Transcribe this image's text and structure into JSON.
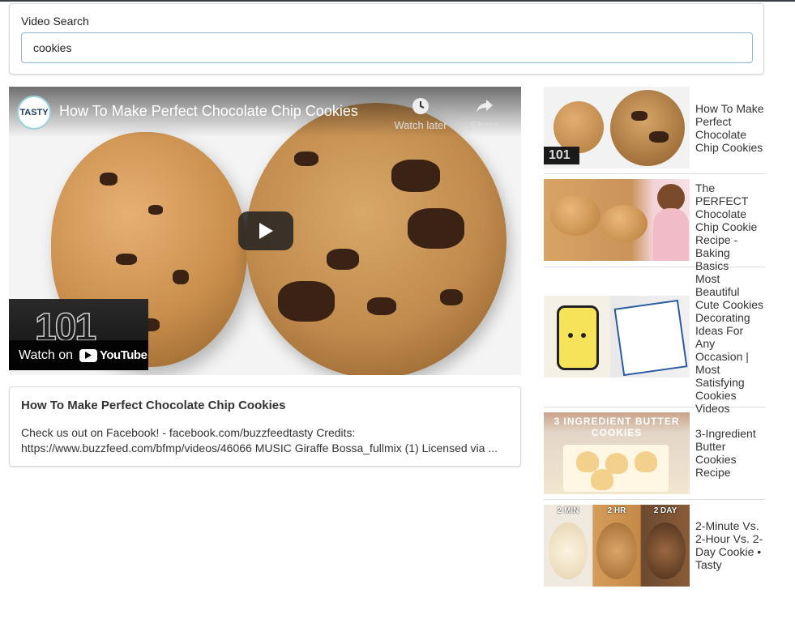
{
  "search": {
    "label": "Video Search",
    "value": "cookies",
    "placeholder": ""
  },
  "player": {
    "channel": "TASTY",
    "title": "How To Make Perfect Chocolate Chip Cookies",
    "watch_later": "Watch later",
    "share": "Share",
    "badge_number": "101",
    "watch_on": "Watch on",
    "youtube": "YouTube"
  },
  "selected_video": {
    "title": "How To Make Perfect Chocolate Chip Cookies",
    "description": "Check us out on Facebook! - facebook.com/buzzfeedtasty Credits: https://www.buzzfeed.com/bfmp/videos/46066 MUSIC Giraffe Bossa_fullmix (1) Licensed via ..."
  },
  "video_list": [
    {
      "title": "How To Make Perfect Chocolate Chip Cookies",
      "thumb_text": "101"
    },
    {
      "title": "The PERFECT Chocolate Chip Cookie Recipe - Baking Basics",
      "thumb_text": ""
    },
    {
      "title": "Most Beautiful Cute Cookies Decorating Ideas For Any Occasion | Most Satisfying Cookies Videos",
      "thumb_text": ""
    },
    {
      "title": "3-Ingredient Butter Cookies Recipe",
      "thumb_text": "3 INGREDIENT BUTTER COOKIES"
    },
    {
      "title": "2-Minute Vs. 2-Hour Vs. 2-Day Cookie • Tasty",
      "thumb_text_a": "2 MIN",
      "thumb_text_b": "2 HR",
      "thumb_text_c": "2 DAY"
    }
  ]
}
